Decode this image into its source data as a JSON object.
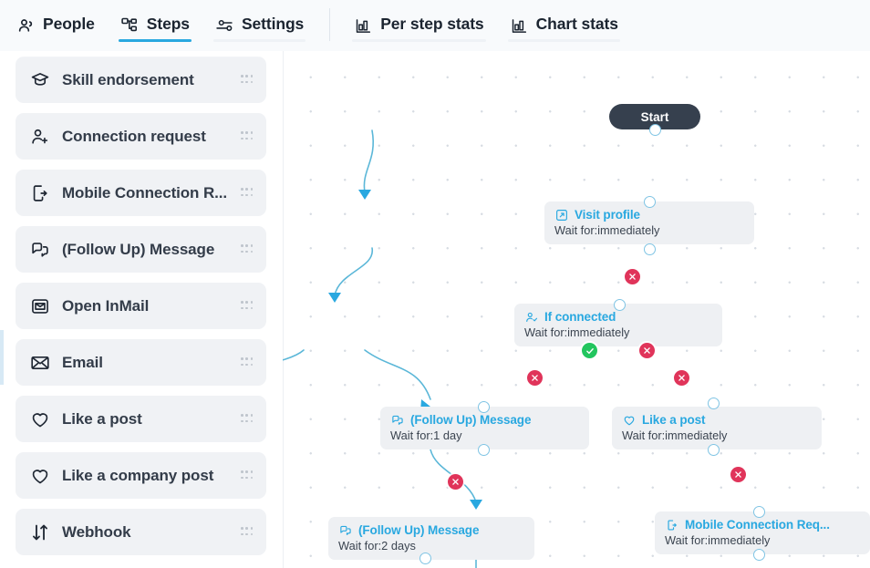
{
  "header": {
    "primary_tabs": [
      {
        "label": "People",
        "icon": "people-icon",
        "active": false
      },
      {
        "label": "Steps",
        "icon": "steps-icon",
        "active": true
      },
      {
        "label": "Settings",
        "icon": "sliders-icon",
        "active": false
      }
    ],
    "secondary_tabs": [
      {
        "label": "Per step stats",
        "icon": "bar-chart-icon",
        "active": false
      },
      {
        "label": "Chart stats",
        "icon": "bar-chart-icon",
        "active": false
      }
    ],
    "active_tab_accent": "#29a8e0"
  },
  "sidebar": {
    "items": [
      {
        "label": "Skill endorsement",
        "icon": "graduation-cap-icon"
      },
      {
        "label": "Connection request",
        "icon": "user-plus-icon"
      },
      {
        "label": "Mobile Connection R...",
        "icon": "mobile-connect-icon"
      },
      {
        "label": "(Follow Up) Message",
        "icon": "chat-bubbles-icon"
      },
      {
        "label": "Open InMail",
        "icon": "inmail-icon"
      },
      {
        "label": "Email",
        "icon": "envelope-icon"
      },
      {
        "label": "Like a post",
        "icon": "heart-icon"
      },
      {
        "label": "Like a company post",
        "icon": "heart-icon"
      },
      {
        "label": "Webhook",
        "icon": "arrows-updown-icon"
      }
    ],
    "drag_handle_icon": "drag-handle-icon"
  },
  "canvas": {
    "start_label": "Start",
    "wait_prefix": "Wait for:",
    "connector_color": "#5bb7d8",
    "delete_badge_color": "#e0345a",
    "success_badge_color": "#22c55e",
    "nodes": [
      {
        "id": "visit-profile",
        "title": "Visit profile",
        "wait": "Wait for:immediately",
        "icon": "visit-profile-icon"
      },
      {
        "id": "if-connected",
        "title": "If connected",
        "wait": "Wait for:immediately",
        "icon": "if-connected-icon"
      },
      {
        "id": "follow-up-1day",
        "title": "(Follow Up) Message",
        "wait": "Wait for:1 day",
        "icon": "chat-bubbles-icon"
      },
      {
        "id": "like-a-post",
        "title": "Like a post",
        "wait": "Wait for:immediately",
        "icon": "heart-icon"
      },
      {
        "id": "follow-up-2days",
        "title": "(Follow Up) Message",
        "wait": "Wait for:2 days",
        "icon": "chat-bubbles-icon"
      },
      {
        "id": "mobile-conn-req",
        "title": "Mobile Connection Req...",
        "wait": "Wait for:immediately",
        "icon": "mobile-connect-icon"
      }
    ]
  }
}
